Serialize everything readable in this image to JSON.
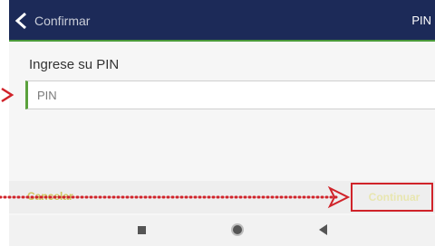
{
  "header": {
    "title": "Confirmar",
    "right_label": "PIN",
    "back_icon": "chevron-left-icon"
  },
  "main": {
    "prompt": "Ingrese su PIN",
    "pin_placeholder": "PIN",
    "pin_value": ""
  },
  "actions": {
    "cancel_label": "Cancelar",
    "continue_label": "Continuar"
  },
  "navbar": {
    "recents_icon": "square-icon",
    "home_icon": "circle-icon",
    "back_icon": "triangle-back-icon"
  },
  "colors": {
    "header_bg": "#1c2a58",
    "accent_green": "#5aa13c",
    "annotation_red": "#d0232a"
  }
}
